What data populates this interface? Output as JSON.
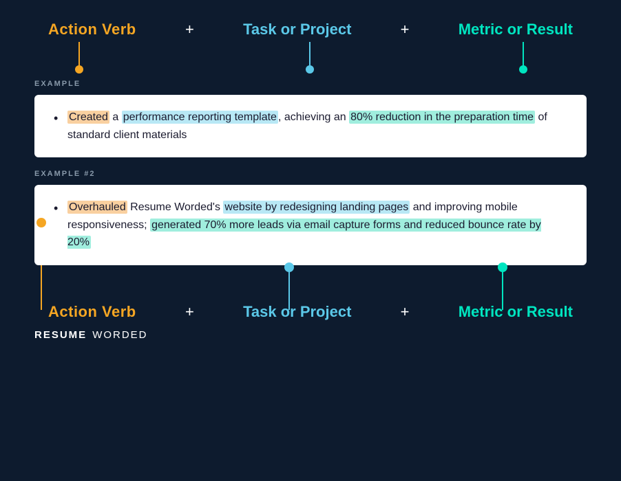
{
  "header": {
    "action_verb_label": "Action Verb",
    "plus1": "+",
    "task_label": "Task or Project",
    "plus2": "+",
    "metric_label": "Metric or Result"
  },
  "example1": {
    "section_label": "EXAMPLE",
    "text_parts": {
      "action_verb": "Created",
      "rest1": " a performance reporting template",
      "rest2": ", achieving an ",
      "metric": "80% reduction in the preparation time",
      "rest3": " of standard client materials"
    }
  },
  "example2": {
    "section_label": "EXAMPLE #2",
    "text_parts": {
      "action_verb": "Overhauled",
      "rest1": " Resume Worded's website by redesigning landing pages",
      "rest2": " and improving mobile responsiveness; ",
      "metric": "generated 70% more leads via email capture forms and reduced bounce rate by 20%",
      "rest3": ""
    }
  },
  "footer": {
    "resume": "RESUME",
    "worded": "WORDED"
  },
  "colors": {
    "action_verb": "#f5a623",
    "task": "#5bc8e8",
    "metric": "#00e5c0",
    "bg": "#0d1b2e",
    "white": "#ffffff"
  }
}
